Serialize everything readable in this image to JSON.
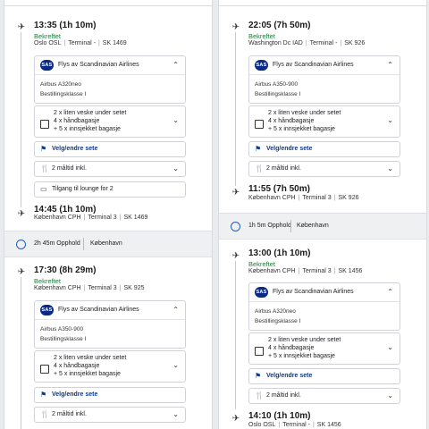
{
  "header": {
    "left_partial": "",
    "right_partial": ""
  },
  "left": {
    "seg1": {
      "dep_time": "13:35 (1h 10m)",
      "status": "Bekreftet",
      "dep_city": "Oslo",
      "dep_code": "OSL",
      "dep_terminal": "Terminal",
      "dep_terminal_no": "-",
      "flight": "SK 1469",
      "airline": "Flys av Scandinavian Airlines",
      "aircraft": "Airbus A320neo",
      "booking_class": "Bestillingsklasse I",
      "bag1": "2 x liten veske under setet",
      "bag2": "4 x håndbagasje",
      "bag3": "+ 5 x innsjekket bagasje",
      "seat": "Velg/endre sete",
      "meals": "2 måltid inkl.",
      "lounge": "Tilgang til lounge for 2",
      "arr_time": "14:45 (1h 10m)",
      "arr_city": "København",
      "arr_code": "CPH",
      "arr_terminal": "Terminal",
      "arr_terminal_no": "3",
      "arr_flight": "SK 1469"
    },
    "layover": {
      "duration": "2h 45m Opphold",
      "city": "København"
    },
    "seg2": {
      "dep_time": "17:30 (8h 29m)",
      "status": "Bekreftet",
      "dep_city": "København",
      "dep_code": "CPH",
      "dep_terminal": "Terminal",
      "dep_terminal_no": "3",
      "flight": "SK 925",
      "airline": "Flys av Scandinavian Airlines",
      "aircraft": "Airbus A350-900",
      "booking_class": "Bestillingsklasse I",
      "bag1": "2 x liten veske under setet",
      "bag2": "4 x håndbagasje",
      "bag3": "+ 5 x innsjekket bagasje",
      "seat": "Velg/endre sete",
      "meals": "2 måltid inkl."
    }
  },
  "right": {
    "seg1": {
      "dep_time": "22:05 (7h 50m)",
      "status": "Bekreftet",
      "dep_city": "Washington Dc",
      "dep_code": "IAD",
      "dep_terminal": "Terminal",
      "dep_terminal_no": "-",
      "flight": "SK 926",
      "airline": "Flys av Scandinavian Airlines",
      "aircraft": "Airbus A350-900",
      "booking_class": "Bestillingsklasse I",
      "bag1": "2 x liten veske under setet",
      "bag2": "4 x håndbagasje",
      "bag3": "+ 5 x innsjekket bagasje",
      "seat": "Velg/endre sete",
      "meals": "2 måltid inkl.",
      "arr_time": "11:55 (7h 50m)",
      "arr_city": "København",
      "arr_code": "CPH",
      "arr_terminal": "Terminal",
      "arr_terminal_no": "3",
      "arr_flight": "SK 926"
    },
    "layover": {
      "duration": "1h 5m Opphold",
      "city": "København"
    },
    "seg2": {
      "dep_time": "13:00 (1h 10m)",
      "status": "Bekreftet",
      "dep_city": "København",
      "dep_code": "CPH",
      "dep_terminal": "Terminal",
      "dep_terminal_no": "3",
      "flight": "SK 1456",
      "airline": "Flys av Scandinavian Airlines",
      "aircraft": "Airbus A320neo",
      "booking_class": "Bestillingsklasse I",
      "bag1": "2 x liten veske under setet",
      "bag2": "4 x håndbagasje",
      "bag3": "+ 5 x innsjekket bagasje",
      "seat": "Velg/endre sete",
      "meals": "2 måltid inkl.",
      "arr_time": "14:10 (1h 10m)",
      "arr_city": "Oslo",
      "arr_code": "OSL",
      "arr_terminal": "Terminal",
      "arr_terminal_no": "-",
      "arr_flight": "SK 1456"
    }
  },
  "logo_text": "SAS",
  "colors": {
    "confirmed": "#1a7d3a",
    "link": "#0b3a8c",
    "sas_blue": "#0b2a84"
  }
}
